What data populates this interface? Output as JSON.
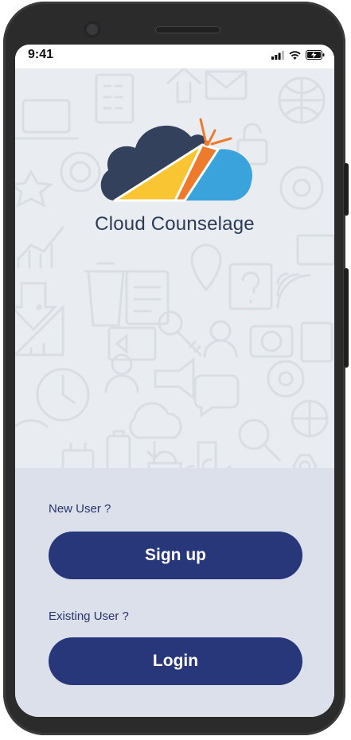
{
  "status_bar": {
    "time": "9:41"
  },
  "brand": {
    "name": "Cloud Counselage"
  },
  "signup": {
    "prompt": "New User ?",
    "button_label": "Sign up"
  },
  "login": {
    "prompt": "Existing User ?",
    "button_label": "Login"
  },
  "colors": {
    "primary": "#27377a",
    "cloud_dark": "#33415c",
    "cloud_blue": "#3aa3dc",
    "ray_yellow": "#f9c532",
    "ray_orange": "#ec7b2d",
    "panel": "#dbe0ea",
    "background": "#e9edf1"
  }
}
